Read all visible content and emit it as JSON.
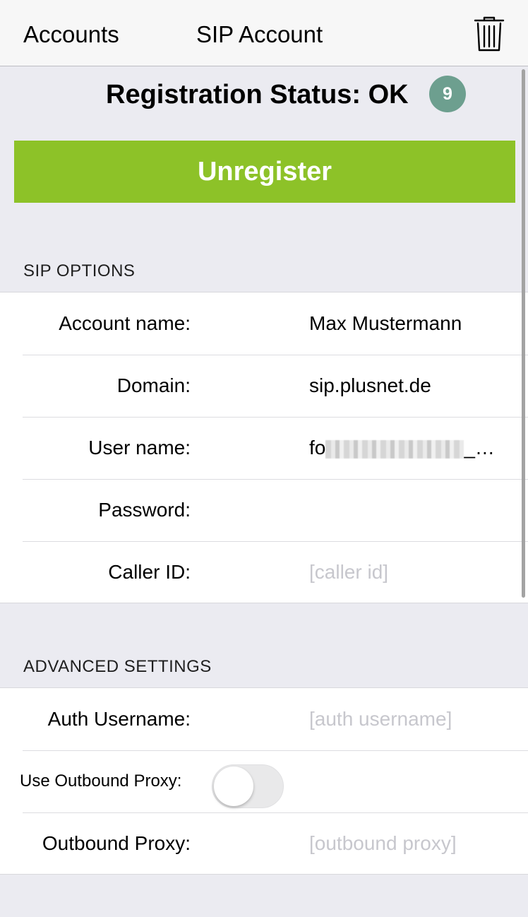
{
  "nav": {
    "back_label": "Accounts",
    "title": "SIP Account",
    "trash_icon": "trash-icon"
  },
  "status": {
    "text": "Registration Status: OK",
    "badge": "9"
  },
  "unregister_label": "Unregister",
  "sip_options": {
    "header": "SIP OPTIONS",
    "rows": [
      {
        "label": "Account name:",
        "value": "Max Mustermann"
      },
      {
        "label": "Domain:",
        "value": "sip.plusnet.de"
      },
      {
        "label": "User name:",
        "value_prefix": "fo",
        "value_suffix": "_…"
      },
      {
        "label": "Password:",
        "value": ""
      },
      {
        "label": "Caller ID:",
        "placeholder": "[caller id]"
      }
    ]
  },
  "advanced": {
    "header": "ADVANCED SETTINGS",
    "rows": [
      {
        "label": "Auth Username:",
        "placeholder": "[auth username]"
      },
      {
        "label": "Use Outbound Proxy:",
        "toggle_on": false
      },
      {
        "label": "Outbound Proxy:",
        "placeholder": "[outbound proxy]"
      }
    ]
  },
  "colors": {
    "accent_green": "#8dc228",
    "badge": "#6d9f8f",
    "background": "#ebebf1"
  }
}
